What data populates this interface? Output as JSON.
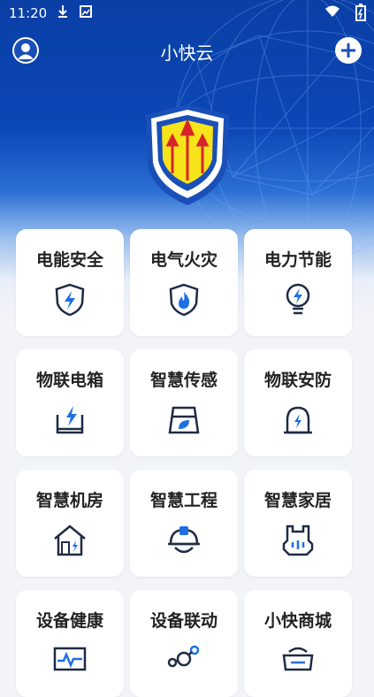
{
  "status_bar": {
    "time": "11:20"
  },
  "header": {
    "title": "小快云"
  },
  "tiles": [
    {
      "label": "电能安全",
      "icon": "lightning-shield-icon"
    },
    {
      "label": "电气火灾",
      "icon": "fire-shield-icon"
    },
    {
      "label": "电力节能",
      "icon": "energy-bulb-icon"
    },
    {
      "label": "物联电箱",
      "icon": "iot-box-icon"
    },
    {
      "label": "智慧传感",
      "icon": "sensor-icon"
    },
    {
      "label": "物联安防",
      "icon": "security-alarm-icon"
    },
    {
      "label": "智慧机房",
      "icon": "server-room-icon"
    },
    {
      "label": "智慧工程",
      "icon": "hardhat-icon"
    },
    {
      "label": "智慧家居",
      "icon": "smart-home-icon"
    },
    {
      "label": "设备健康",
      "icon": "device-health-icon"
    },
    {
      "label": "设备联动",
      "icon": "device-link-icon"
    },
    {
      "label": "小快商城",
      "icon": "mall-icon"
    }
  ],
  "colors": {
    "primary": "#0b47b6",
    "accent": "#1a5ad7",
    "icon_stroke": "#1f2a44",
    "icon_fill": "#1f6fe5"
  }
}
